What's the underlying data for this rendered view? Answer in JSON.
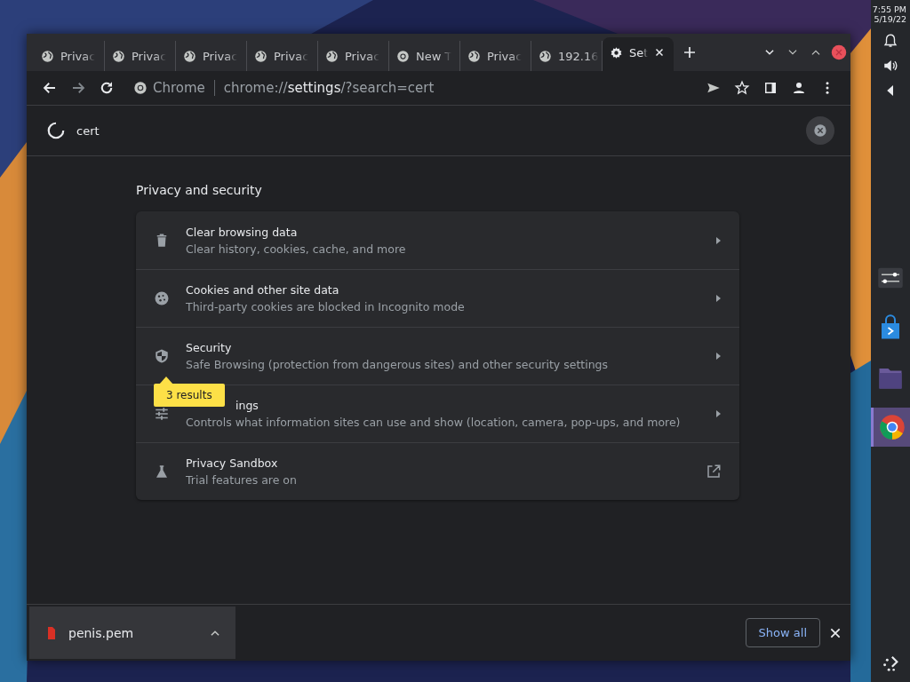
{
  "tabs": [
    {
      "title": "Privac",
      "kind": "site",
      "selected": false
    },
    {
      "title": "Privac",
      "kind": "site",
      "selected": false
    },
    {
      "title": "Privac",
      "kind": "site",
      "selected": false
    },
    {
      "title": "Privac",
      "kind": "site",
      "selected": false
    },
    {
      "title": "Privac",
      "kind": "site",
      "selected": false
    },
    {
      "title": "New T",
      "kind": "newtab",
      "selected": false
    },
    {
      "title": "Privac",
      "kind": "site",
      "selected": false
    },
    {
      "title": "192.16",
      "kind": "site",
      "selected": false
    },
    {
      "title": "Set",
      "kind": "settings",
      "selected": true
    }
  ],
  "omnibox": {
    "site_label": "Chrome",
    "url_scheme": "chrome://",
    "url_host": "settings",
    "url_rest": "/?search=cert"
  },
  "search": {
    "value": "cert"
  },
  "section": {
    "title": "Privacy and security",
    "items": [
      {
        "title": "Clear browsing data",
        "subtitle": "Clear history, cookies, cache, and more",
        "kind": "subpage"
      },
      {
        "title": "Cookies and other site data",
        "subtitle": "Third-party cookies are blocked in Incognito mode",
        "kind": "subpage"
      },
      {
        "title": "Security",
        "subtitle": "Safe Browsing (protection from dangerous sites) and other security settings",
        "kind": "subpage"
      },
      {
        "title": "ings",
        "subtitle": "Controls what information sites can use and show (location, camera, pop-ups, and more)",
        "kind": "subpage",
        "tooltip": "3 results"
      },
      {
        "title": "Privacy Sandbox",
        "subtitle": "Trial features are on",
        "kind": "external"
      }
    ]
  },
  "downloads": {
    "file": "penis.pem",
    "button": "Show all"
  },
  "system": {
    "time": "7:55 PM",
    "date": "5/19/22"
  }
}
